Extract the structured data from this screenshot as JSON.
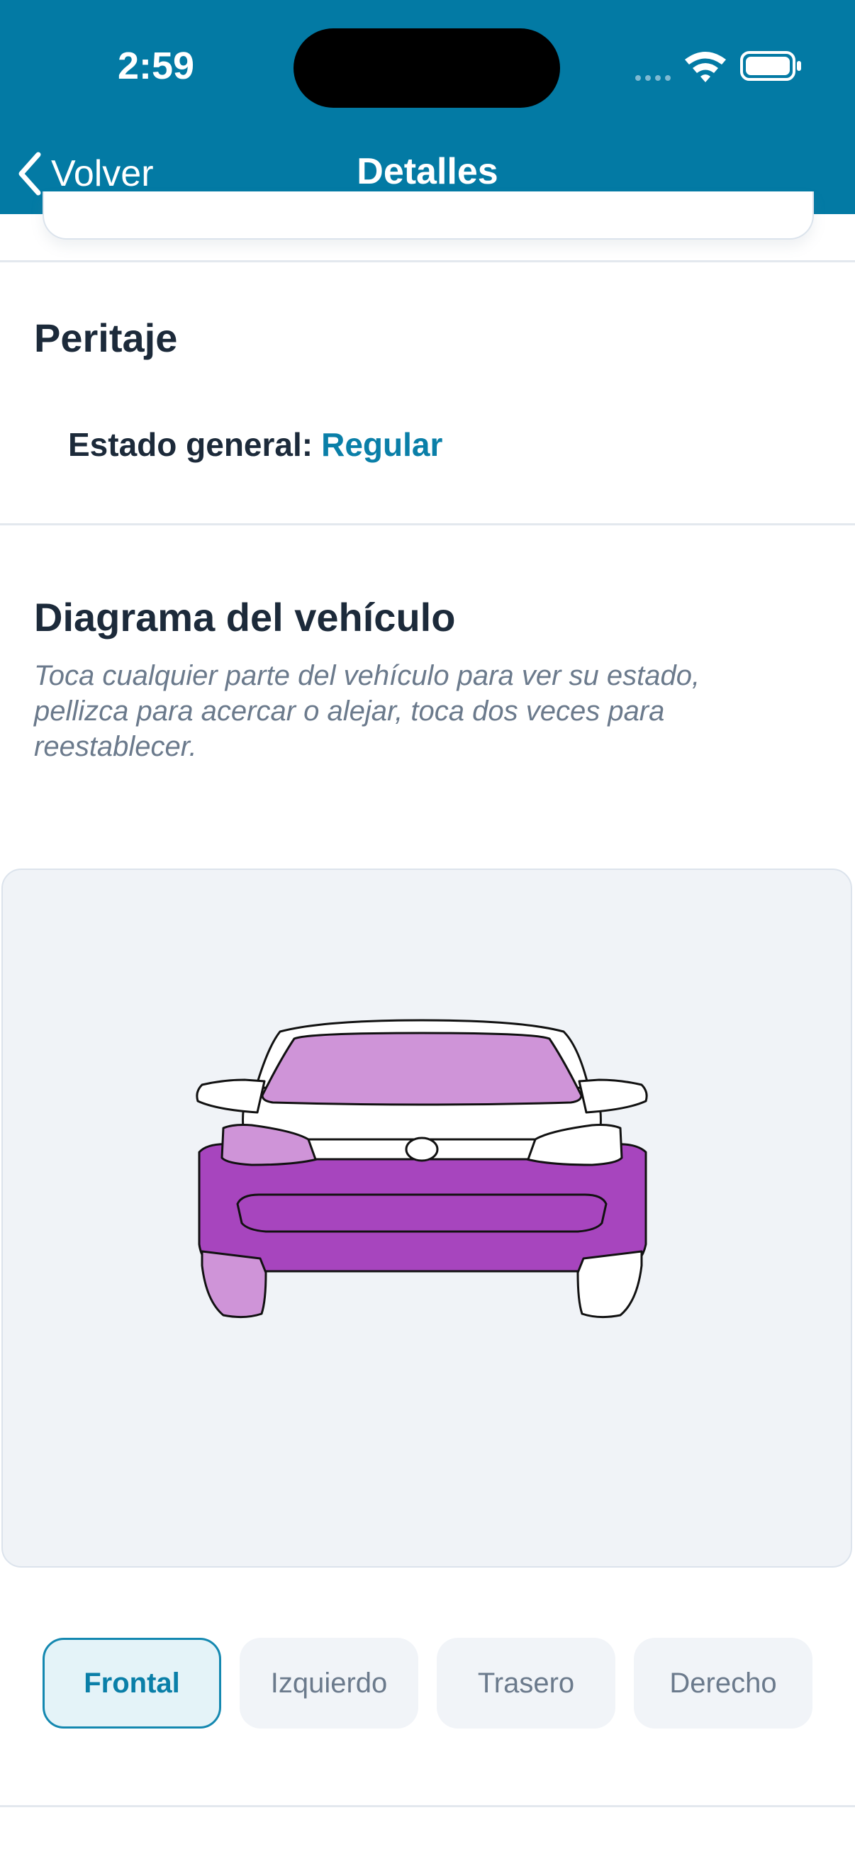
{
  "status_bar": {
    "time": "2:59"
  },
  "nav": {
    "back_label": "Volver",
    "title": "Detalles"
  },
  "peritaje": {
    "title": "Peritaje",
    "estado_label": "Estado general:",
    "estado_value": "Regular"
  },
  "diagram": {
    "title": "Diagrama del vehículo",
    "hint": "Toca cualquier parte del vehículo para ver su estado, pellizca para acercar o alejar, toca dos veces para reestablecer.",
    "view": "Frontal",
    "colors": {
      "light_damage": "#cf94d8",
      "heavy_damage": "#a745be",
      "outline": "#111111"
    }
  },
  "views": {
    "tabs": [
      {
        "label": "Frontal",
        "active": true
      },
      {
        "label": "Izquierdo",
        "active": false
      },
      {
        "label": "Trasero",
        "active": false
      },
      {
        "label": "Derecho",
        "active": false
      }
    ]
  },
  "colors": {
    "header": "#037aa4",
    "accent": "#0a7fa8"
  }
}
